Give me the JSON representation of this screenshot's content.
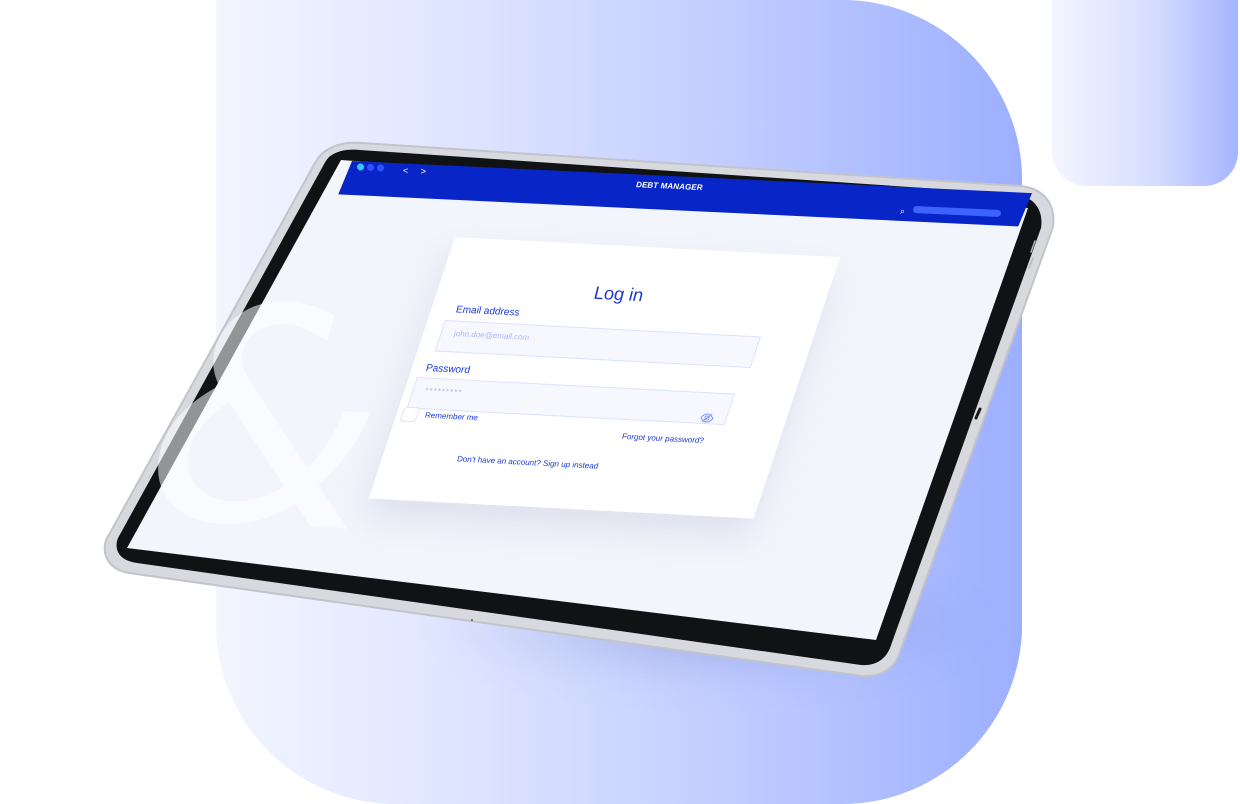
{
  "app": {
    "title": "DEBT MANAGER"
  },
  "nav": {
    "arrows": "< >"
  },
  "login": {
    "title": "Log in",
    "email_label": "Email address",
    "email_placeholder": "john.doe@email.com",
    "password_label": "Password",
    "password_placeholder": "*********",
    "remember_label": "Remember me",
    "forgot_link": "Forgot your password?",
    "signup_link": "Don't have an account? Sign up instead"
  },
  "icons": {
    "search": "search-icon",
    "password_visibility": "eye-slash-icon"
  },
  "colors": {
    "primary": "#1938d6",
    "topbar": "#0826c7",
    "accent_blob": "#9cafff",
    "screen": "#f3f5fc"
  }
}
